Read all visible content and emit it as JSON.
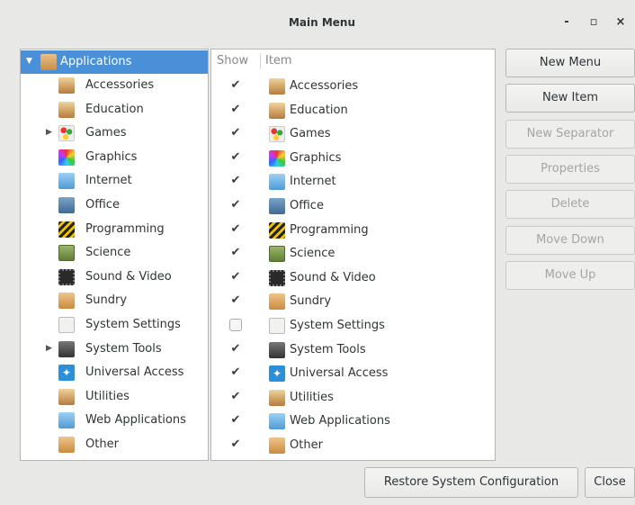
{
  "window": {
    "title": "Main Menu",
    "minimize_glyph": "-",
    "maximize_glyph": "▫",
    "close_glyph": "×"
  },
  "tree": {
    "root_label": "Applications",
    "items": [
      {
        "label": "Accessories",
        "icon": "accessories-icon",
        "expandable": false
      },
      {
        "label": "Education",
        "icon": "education-icon",
        "expandable": false
      },
      {
        "label": "Games",
        "icon": "games-icon",
        "expandable": true
      },
      {
        "label": "Graphics",
        "icon": "graphics-icon",
        "expandable": false
      },
      {
        "label": "Internet",
        "icon": "internet-icon",
        "expandable": false
      },
      {
        "label": "Office",
        "icon": "office-icon",
        "expandable": false
      },
      {
        "label": "Programming",
        "icon": "programming-icon",
        "expandable": false
      },
      {
        "label": "Science",
        "icon": "science-icon",
        "expandable": false
      },
      {
        "label": "Sound & Video",
        "icon": "sound-video-icon",
        "expandable": false
      },
      {
        "label": "Sundry",
        "icon": "sundry-icon",
        "expandable": false
      },
      {
        "label": "System Settings",
        "icon": "system-settings-icon",
        "expandable": false
      },
      {
        "label": "System Tools",
        "icon": "system-tools-icon",
        "expandable": true
      },
      {
        "label": "Universal Access",
        "icon": "universal-access-icon",
        "expandable": false
      },
      {
        "label": "Utilities",
        "icon": "utilities-icon",
        "expandable": false
      },
      {
        "label": "Web Applications",
        "icon": "web-applications-icon",
        "expandable": false
      },
      {
        "label": "Other",
        "icon": "other-icon",
        "expandable": false
      }
    ]
  },
  "list": {
    "columns": [
      "Show",
      "Item"
    ],
    "rows": [
      {
        "label": "Accessories",
        "shown": true
      },
      {
        "label": "Education",
        "shown": true
      },
      {
        "label": "Games",
        "shown": true
      },
      {
        "label": "Graphics",
        "shown": true
      },
      {
        "label": "Internet",
        "shown": true
      },
      {
        "label": "Office",
        "shown": true
      },
      {
        "label": "Programming",
        "shown": true
      },
      {
        "label": "Science",
        "shown": true
      },
      {
        "label": "Sound & Video",
        "shown": true
      },
      {
        "label": "Sundry",
        "shown": true
      },
      {
        "label": "System Settings",
        "shown": false
      },
      {
        "label": "System Tools",
        "shown": true
      },
      {
        "label": "Universal Access",
        "shown": true
      },
      {
        "label": "Utilities",
        "shown": true
      },
      {
        "label": "Web Applications",
        "shown": true
      },
      {
        "label": "Other",
        "shown": true
      }
    ]
  },
  "buttons": {
    "new_menu": "New Menu",
    "new_item": "New Item",
    "new_separator": "New Separator",
    "properties": "Properties",
    "delete": "Delete",
    "move_down": "Move Down",
    "move_up": "Move Up",
    "restore": "Restore System Configuration",
    "close": "Close"
  },
  "colors": {
    "selection": "#4a90d9",
    "window_bg": "#e8e8e7"
  }
}
